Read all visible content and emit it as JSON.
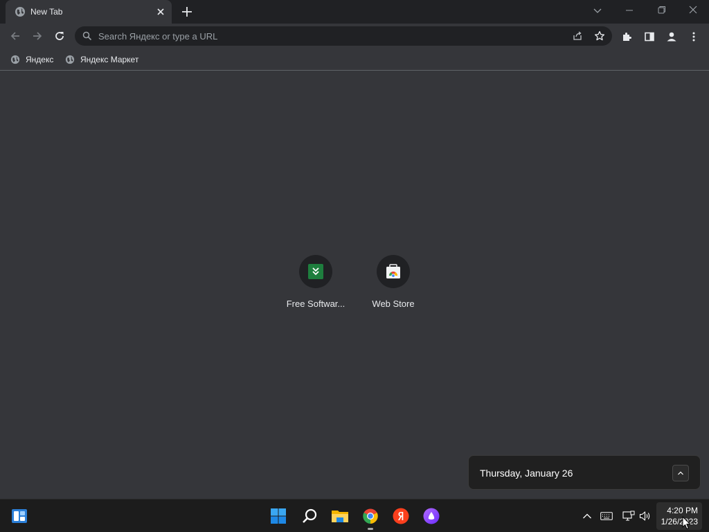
{
  "window": {
    "tab_title": "New Tab",
    "controls": [
      "tab-search-icon",
      "minimize-icon",
      "restore-icon",
      "close-icon"
    ]
  },
  "toolbar": {
    "omnibox_placeholder": "Search Яндекс or type a URL",
    "icons": [
      "back-icon",
      "forward-icon",
      "reload-icon",
      "share-icon",
      "bookmark-star-icon",
      "extensions-icon",
      "side-panel-icon",
      "profile-icon",
      "menu-icon"
    ]
  },
  "bookmarks": [
    {
      "label": "Яндекс",
      "icon": "globe-icon"
    },
    {
      "label": "Яндекс Маркет",
      "icon": "globe-icon"
    }
  ],
  "shortcuts": [
    {
      "label": "Free Softwar...",
      "icon": "download-app-icon"
    },
    {
      "label": "Web Store",
      "icon": "web-store-icon"
    }
  ],
  "flyout": {
    "date_text": "Thursday, January 26"
  },
  "taskbar": {
    "apps": [
      "widgets-icon",
      "start-icon",
      "search-icon",
      "file-explorer-icon",
      "chrome-icon",
      "yandex-browser-icon",
      "alice-icon"
    ],
    "tray_icons": [
      "show-hidden-icons-icon",
      "keyboard-icon",
      "network-icon",
      "volume-icon"
    ],
    "time": "4:20 PM",
    "date": "1/26/2023"
  },
  "colors": {
    "page_bg": "#35363a",
    "tabstrip_bg": "#202124",
    "omnibox_bg": "#202124",
    "taskbar_bg": "#1c1c1c"
  }
}
